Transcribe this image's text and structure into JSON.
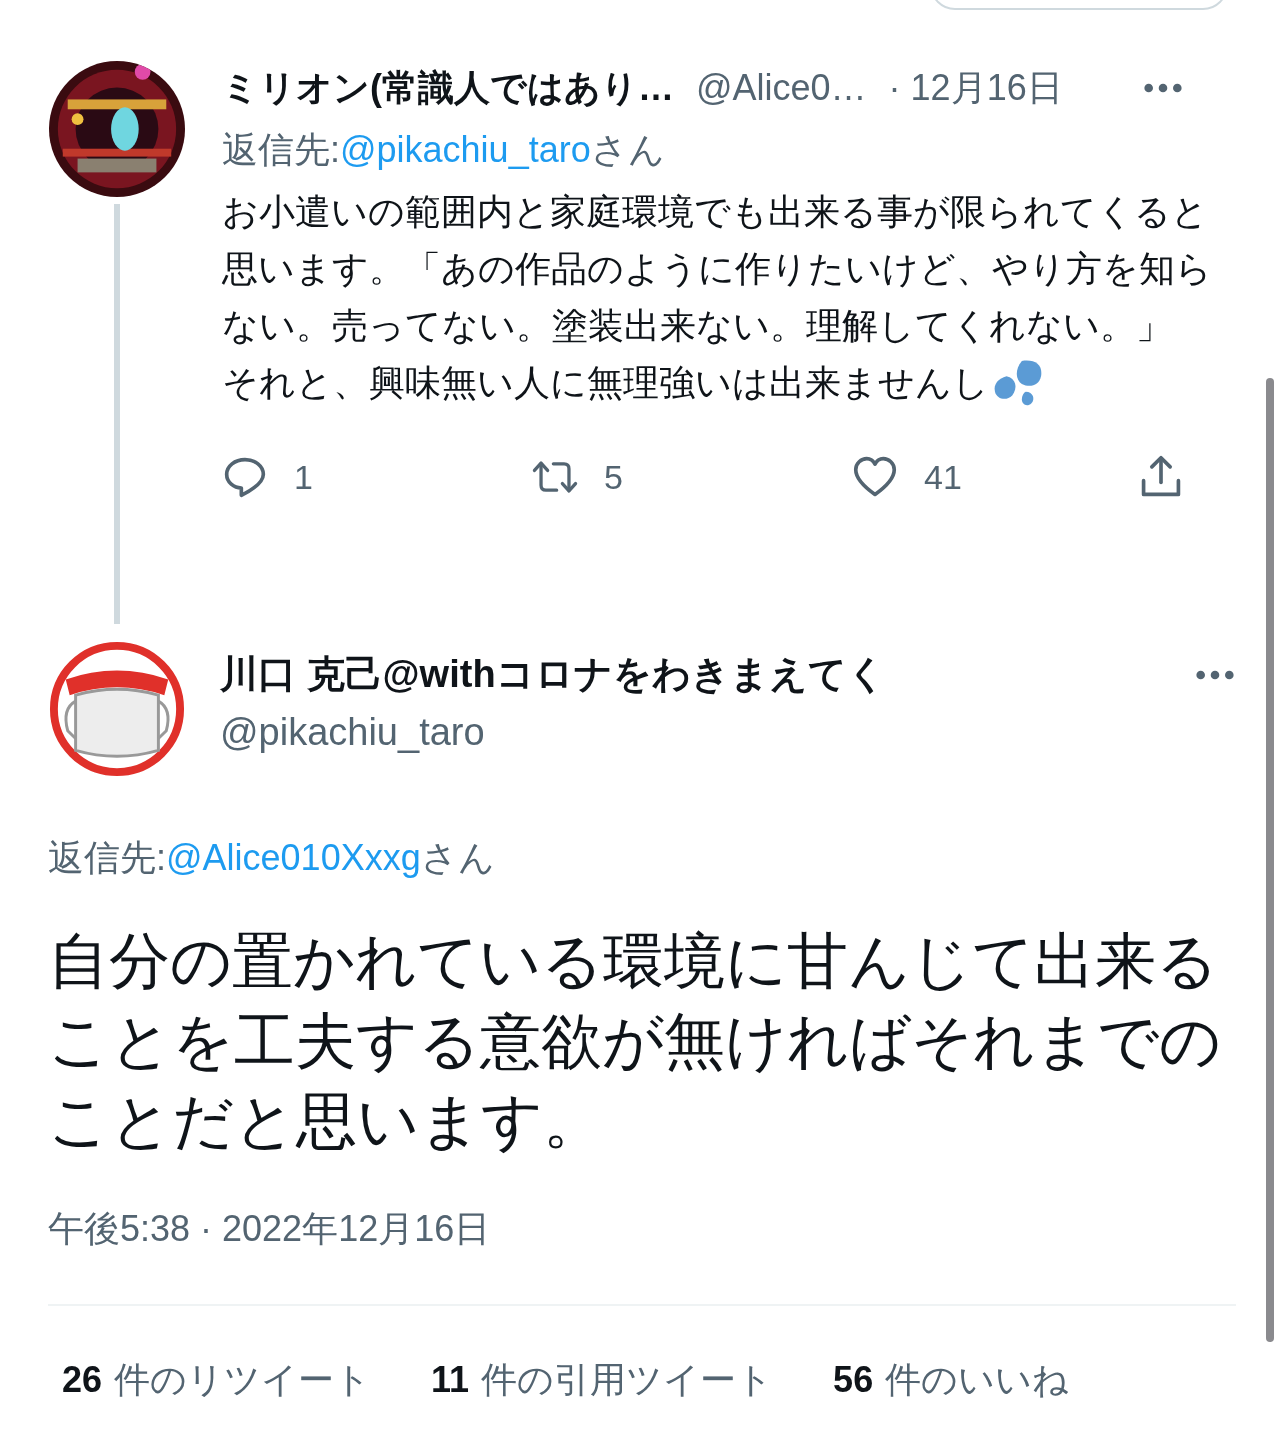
{
  "reply_tweet": {
    "display_name": "ミリオン(常識人ではあり…",
    "handle": "@Alice0…",
    "date": "· 12月16日",
    "reply_label": "返信先:",
    "reply_to": "@pikachiu_taro",
    "reply_suffix": "さん",
    "paragraphs": [
      "お小遣いの範囲内と家庭環境でも出来る事が限られてくると思います。「あの作品のように作りたいけど、やり方を知らない。売ってない。塗装出来ない。理解してくれない。」",
      "それと、興味無い人に無理強いは出来ませんし"
    ],
    "actions": [
      {
        "kind": "reply",
        "count": "1"
      },
      {
        "kind": "retweet",
        "count": "5"
      },
      {
        "kind": "like",
        "count": "41"
      },
      {
        "kind": "share"
      }
    ]
  },
  "main_tweet": {
    "display_name": "川口 克己@withコロナをわきまえてく",
    "handle": "@pikachiu_taro",
    "reply_label": "返信先:",
    "reply_to": "@Alice010Xxxg",
    "reply_suffix": "さん",
    "text": "自分の置かれている環境に甘んじて出来ることを工夫する意欲が無ければそれまでのことだと思います。",
    "timestamp": "午後5:38 · 2022年12月16日",
    "stats": [
      {
        "count": "26",
        "label": "件のリツイート"
      },
      {
        "count": "11",
        "label": "件の引用ツイート"
      },
      {
        "count": "56",
        "label": "件のいいね"
      }
    ]
  }
}
